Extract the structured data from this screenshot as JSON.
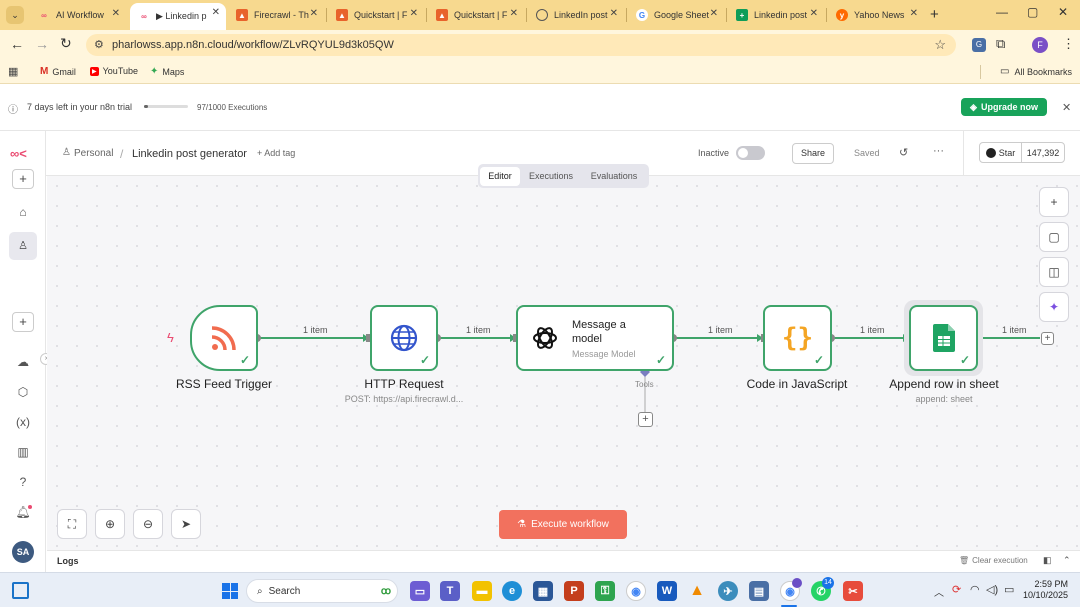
{
  "browser": {
    "tabs": [
      {
        "title": "AI Workflow",
        "favicon": "n8n-icon",
        "color": "#ea4b71",
        "active": false
      },
      {
        "title": "▶ Linkedin p",
        "favicon": "n8n-icon",
        "color": "#ea4b71",
        "active": true
      },
      {
        "title": "Firecrawl - Th",
        "favicon": "firecrawl-icon",
        "color": "#e8632b",
        "active": false
      },
      {
        "title": "Quickstart | F",
        "favicon": "firecrawl-icon",
        "color": "#e8632b",
        "active": false
      },
      {
        "title": "Quickstart | F",
        "favicon": "firecrawl-icon",
        "color": "#e8632b",
        "active": false
      },
      {
        "title": "LinkedIn post",
        "favicon": "globe-icon",
        "color": "#555555",
        "active": false
      },
      {
        "title": "Google Sheet",
        "favicon": "google-icon",
        "color": "#4285f4",
        "active": false
      },
      {
        "title": "Linkedin post",
        "favicon": "sheets-icon",
        "color": "#0f9d58",
        "active": false
      },
      {
        "title": "Yahoo News",
        "favicon": "yahoo-icon",
        "color": "#ff6a00",
        "active": false
      }
    ],
    "url": "pharlowss.app.n8n.cloud/workflow/ZLvRQYUL9d3k05QW",
    "profile_initial": "F",
    "bookmarks": [
      {
        "label": "Gmail",
        "icon": "gmail-icon"
      },
      {
        "label": "YouTube",
        "icon": "youtube-icon"
      },
      {
        "label": "Maps",
        "icon": "maps-icon"
      }
    ],
    "all_bookmarks": "All Bookmarks"
  },
  "banner": {
    "trial_text": "7 days left in your n8n trial",
    "executions": "97/1000 Executions",
    "executions_fraction": 0.097,
    "upgrade_label": "Upgrade now"
  },
  "header": {
    "project": "Personal",
    "workflow_name": "Linkedin post generator",
    "add_tag": "+ Add tag",
    "status_label": "Inactive",
    "share_label": "Share",
    "saved_label": "Saved",
    "star_label": "Star",
    "star_count": "147,392"
  },
  "view_tabs": [
    "Editor",
    "Executions",
    "Evaluations"
  ],
  "nodes": [
    {
      "name": "RSS Feed Trigger",
      "subtitle": ""
    },
    {
      "name": "HTTP Request",
      "subtitle": "POST: https://api.firecrawl.d..."
    },
    {
      "name": "Message a model",
      "subtitle": "Message Model",
      "tools_label": "Tools"
    },
    {
      "name": "Code in JavaScript",
      "subtitle": ""
    },
    {
      "name": "Append row in sheet",
      "subtitle": "append: sheet"
    }
  ],
  "edges": [
    "1 item",
    "1 item",
    "1 item",
    "1 item",
    "1 item"
  ],
  "execute_label": "Execute workflow",
  "logs": {
    "label": "Logs",
    "clear_label": "Clear execution"
  },
  "avatar_initials": "SA",
  "taskbar": {
    "search_label": "Search",
    "time": "2:59 PM",
    "date": "10/10/2025",
    "notification_badge": "14"
  },
  "colors": {
    "accent": "#ea4b71",
    "success": "#3fa46a",
    "execute": "#f2715e",
    "upgrade": "#18a35a"
  }
}
